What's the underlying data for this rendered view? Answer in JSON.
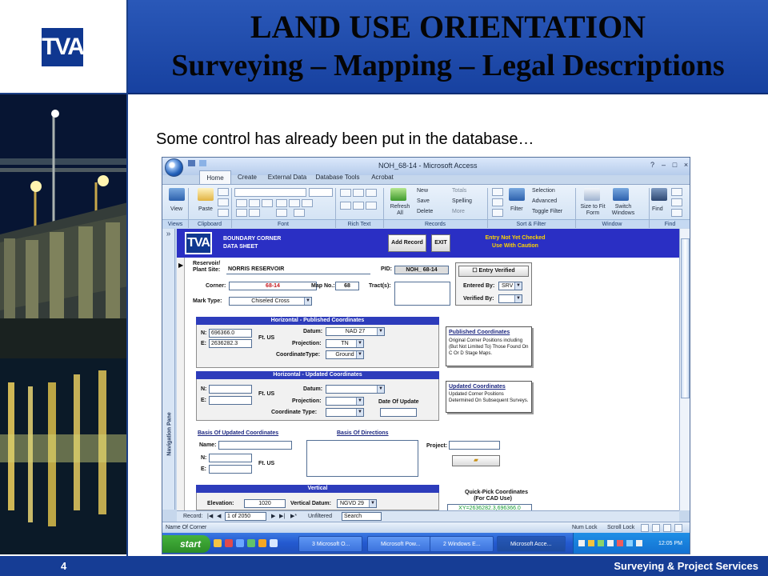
{
  "slide": {
    "logo_text": "TVA",
    "title": "LAND USE ORIENTATION",
    "subtitle": "Surveying – Mapping – Legal Descriptions",
    "caption": "Some control has already been put in the database…",
    "page_number": "4",
    "footer": "Surveying & Project Services"
  },
  "access": {
    "window_title": "NOH_68-14 - Microsoft Access",
    "tabs": [
      "Home",
      "Create",
      "External Data",
      "Database Tools",
      "Acrobat"
    ],
    "groups": [
      "Views",
      "Clipboard",
      "Font",
      "Rich Text",
      "Records",
      "Sort & Filter",
      "Window",
      "Find"
    ],
    "ribbon": {
      "view": "View",
      "paste": "Paste",
      "refresh": "Refresh All",
      "new": "New",
      "save": "Save",
      "delete": "Delete",
      "totals": "Totals",
      "spelling": "Spelling",
      "more": "More",
      "filter": "Filter",
      "selection": "Selection",
      "advanced": "Advanced",
      "toggle_filter": "Toggle Filter",
      "size_to_fit": "Size to Fit Form",
      "switch_windows": "Switch Windows",
      "find": "Find"
    },
    "nav_pane": "Navigation Pane",
    "form": {
      "logo": "TVA",
      "sheet_title_1": "BOUNDARY CORNER",
      "sheet_title_2": "DATA SHEET",
      "add_record": "Add Record",
      "exit": "EXIT",
      "warning_1": "Entry Not Yet Checked",
      "warning_2": "Use With Caution",
      "reservoir_label_1": "Reservoir/",
      "reservoir_label_2": "Plant Site:",
      "reservoir_value": "NORRIS RESERVOIR",
      "pid_label": "PID:",
      "pid_value": "NOH_ 68-14",
      "entry_verified": "Entry Verified",
      "corner_label": "Corner:",
      "corner_value": "68-14",
      "map_no_label": "Map No.:",
      "map_no_value": "68",
      "tracts_label": "Tract(s):",
      "entered_by_label": "Entered By:",
      "entered_by_value": "SRV",
      "mark_type_label": "Mark Type:",
      "mark_type_value": "Chiseled Cross",
      "verified_by_label": "Verified By:",
      "horizontal_published": "Horizontal - Published Coordinates",
      "n_label": "N:",
      "e_label": "E:",
      "n_value": "696366.0",
      "e_value": "2636282.3",
      "ft_us": "Ft. US",
      "datum_label": "Datum:",
      "datum_value": "NAD 27",
      "projection_label": "Projection:",
      "projection_value": "TN",
      "coordinate_type_label": "CoordinateType:",
      "coordinate_type_value": "Ground",
      "published_title": "Published Coordinates",
      "published_body": "Original Corner Positions including (But Not Limited To) Those Found On C Or D Stage Maps.",
      "horizontal_updated": "Horizontal - Updated Coordinates",
      "projection_label_2": "Projection:",
      "coordinate_type_label_2": "Coordinate Type:",
      "date_of_update": "Date Of Update",
      "updated_title": "Updated Coordinates",
      "updated_body": "Updated Corner Positions Determined On Subsequent Surveys.",
      "basis_updated": "Basis Of Updated Coordinates",
      "basis_directions": "Basis Of Directions",
      "name_label": "Name:",
      "project_label": "Project:",
      "vertical": "Vertical",
      "elevation_label": "Elevation:",
      "elevation_value": "1020",
      "vertical_datum_label": "Vertical Datum:",
      "vertical_datum_value": "NGVD 29",
      "quick_pick_1": "Quick-Pick Coordinates",
      "quick_pick_2": "(For CAD Use)",
      "quick_pick_value": "XY=2636282.3,696366.0"
    },
    "record_bar": {
      "label": "Record:",
      "position": "1 of 2050",
      "filter": "Unfiltered",
      "search": "Search"
    },
    "status": {
      "left": "Name Of Corner",
      "num_lock": "Num Lock",
      "scroll_lock": "Scroll Lock"
    },
    "taskbar": {
      "start": "start",
      "items": [
        "3 Microsoft O...",
        "Microsoft Pow...",
        "2 Windows E...",
        "Microsoft Acce..."
      ],
      "clock": "12:05 PM"
    }
  },
  "colors": {
    "brand_blue": "#163d95",
    "title_blue": "#2a58b8",
    "form_header": "#2a2fc4"
  }
}
